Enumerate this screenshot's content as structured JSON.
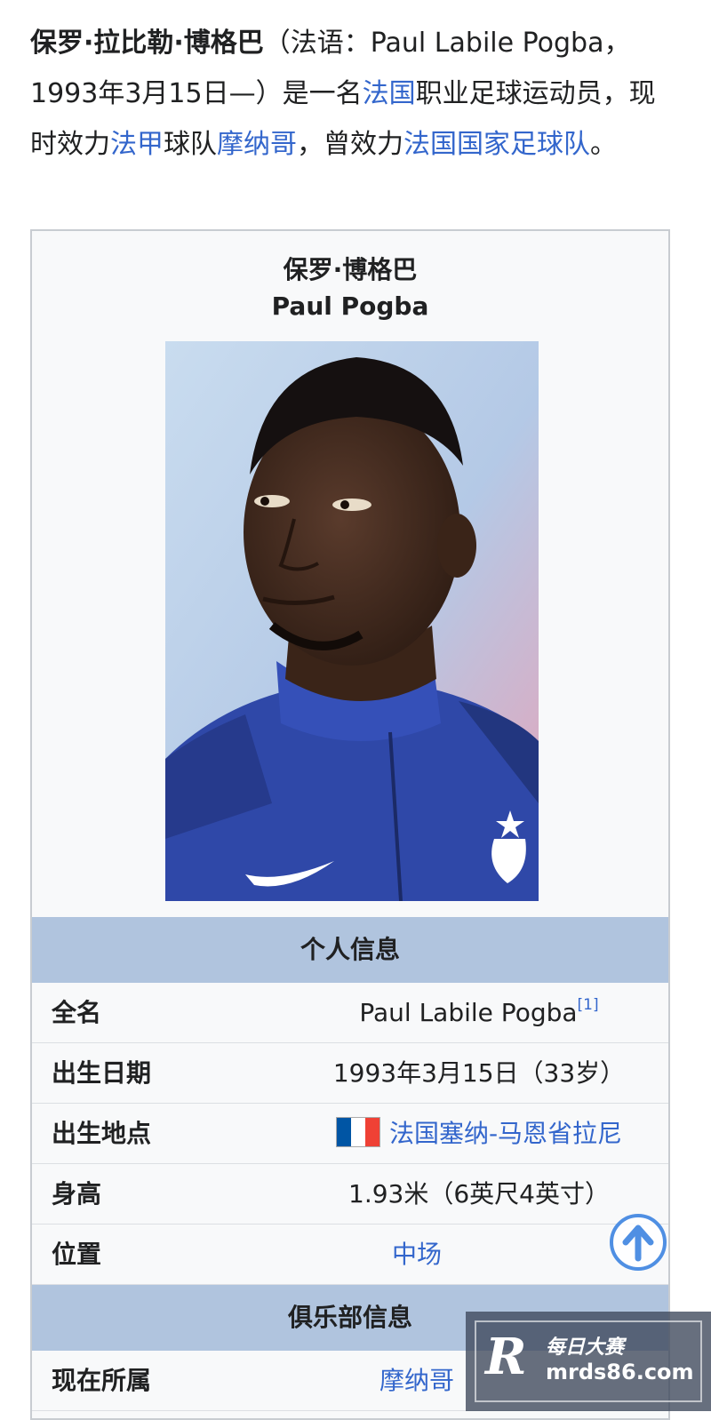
{
  "intro": {
    "name_bold": "保罗·拉比勒·博格巴",
    "text_1": "（法语：Paul Labile Pogba，1993年3月15日—）是一名",
    "link_france": "法国",
    "text_2": "职业足球运动员，现时效力",
    "link_ligue1": "法甲",
    "text_3": "球队",
    "link_monaco": "摩纳哥",
    "text_4": "，曾效力",
    "link_national_team": "法国国家足球队",
    "text_5": "。"
  },
  "infobox": {
    "title_zh": "保罗·博格巴",
    "title_en": "Paul Pogba",
    "personal_header": "个人信息",
    "rows": [
      {
        "label": "全名",
        "value": "Paul Labile Pogba",
        "sup": "[1]"
      },
      {
        "label": "出生日期",
        "value": "1993年3月15日（33岁）"
      },
      {
        "label": "出生地点",
        "value": "法国塞纳-马恩省拉尼"
      },
      {
        "label": "身高",
        "value": "1.93米（6英尺4英寸）"
      },
      {
        "label": "位置",
        "value": "中场"
      }
    ],
    "club_header": "俱乐部信息",
    "club_rows": [
      {
        "label": "现在所属",
        "value": "摩纳哥"
      }
    ]
  },
  "watermark": {
    "line1": "每日大赛",
    "line2": "mrds86.com"
  },
  "colors": {
    "link": "#3366cc",
    "section_header": "#b0c4de",
    "infobox_bg": "#f8f9fa"
  },
  "icons": [
    "up-arrow-icon",
    "flag-france-icon"
  ]
}
